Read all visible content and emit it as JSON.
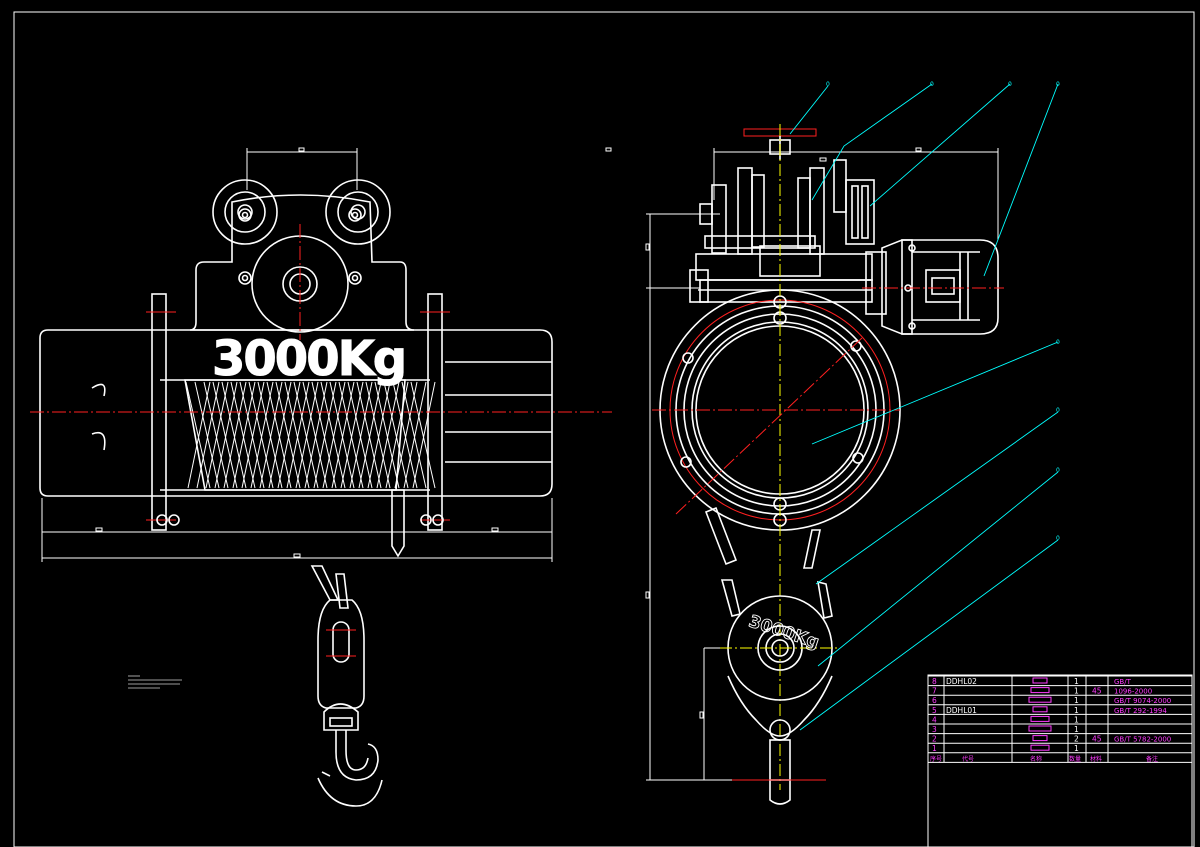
{
  "drawing": {
    "front_view_load_text": "3000Kg",
    "side_view_load_text": "3000Kg"
  },
  "colors": {
    "background": "#000000",
    "outline": "#ffffff",
    "centerline": "#ff2020",
    "side_centerline": "#ffff00",
    "leader": "#00ffff",
    "table_text": "#ff3cff"
  },
  "balloons": [
    "0",
    "0",
    "0",
    "0",
    "0",
    "0",
    "0",
    "0"
  ],
  "parts_list": {
    "rows": [
      {
        "no": "8",
        "code": "DDHL02",
        "qty": "1",
        "material": "",
        "standard": "GB/T"
      },
      {
        "no": "7",
        "code": "",
        "qty": "1",
        "material": "45",
        "standard": "1096-2000"
      },
      {
        "no": "6",
        "code": "",
        "qty": "1",
        "material": "",
        "standard": "GB/T 9074-2000"
      },
      {
        "no": "5",
        "code": "DDHL01",
        "qty": "1",
        "material": "",
        "standard": "GB/T 292-1994"
      },
      {
        "no": "4",
        "code": "",
        "qty": "1",
        "material": "",
        "standard": ""
      },
      {
        "no": "3",
        "code": "",
        "qty": "1",
        "material": "",
        "standard": ""
      },
      {
        "no": "2",
        "code": "",
        "qty": "2",
        "material": "45",
        "standard": "GB/T 5782-2000"
      },
      {
        "no": "1",
        "code": "",
        "qty": "1",
        "material": "",
        "standard": ""
      }
    ],
    "header": {
      "no": "序号",
      "code": "代号",
      "name": "名称",
      "qty": "数量",
      "material": "材料",
      "note": "备注"
    }
  }
}
